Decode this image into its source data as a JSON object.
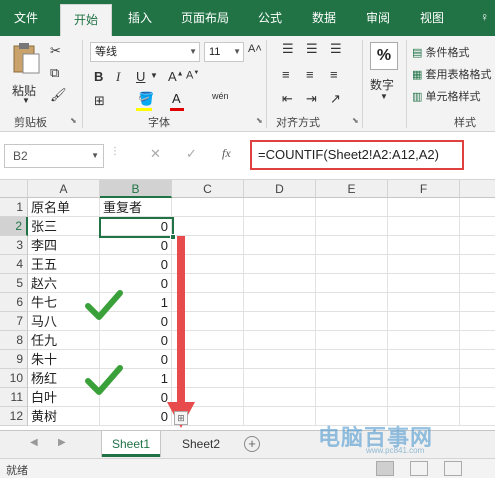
{
  "ribbon_tabs": [
    "文件",
    "开始",
    "插入",
    "页面布局",
    "公式",
    "数据",
    "审阅",
    "视图"
  ],
  "active_tab": "开始",
  "help_icon": "lightbulb-icon",
  "help_text": "♀",
  "clipboard": {
    "paste": "粘贴",
    "label": "剪贴板"
  },
  "font": {
    "name": "等线",
    "size": "11",
    "label": "字体",
    "bold": "B",
    "italic": "I",
    "underline": "U",
    "font_color_letter": "A",
    "phonetic": "wén"
  },
  "alignment": {
    "label": "对齐方式"
  },
  "number": {
    "icon_text": "%",
    "label": "数字"
  },
  "styles": {
    "conditional": "条件格式",
    "table": "套用表格格式",
    "cell": "单元格样式",
    "label": "样式"
  },
  "formula_bar": {
    "name_box": "B2",
    "cancel": "✕",
    "enter": "✓",
    "fx": "fx",
    "formula": "=COUNTIF(Sheet2!A2:A12,A2)"
  },
  "columns": [
    "A",
    "B",
    "C",
    "D",
    "E",
    "F"
  ],
  "rows": [
    {
      "num": "1",
      "a": "原名单",
      "b": "重复者"
    },
    {
      "num": "2",
      "a": "张三",
      "b": "0"
    },
    {
      "num": "3",
      "a": "李四",
      "b": "0"
    },
    {
      "num": "4",
      "a": "王五",
      "b": "0"
    },
    {
      "num": "5",
      "a": "赵六",
      "b": "0"
    },
    {
      "num": "6",
      "a": "牛七",
      "b": "1"
    },
    {
      "num": "7",
      "a": "马八",
      "b": "0"
    },
    {
      "num": "8",
      "a": "任九",
      "b": "0"
    },
    {
      "num": "9",
      "a": "朱十",
      "b": "0"
    },
    {
      "num": "10",
      "a": "杨红",
      "b": "1"
    },
    {
      "num": "11",
      "a": "白叶",
      "b": "0"
    },
    {
      "num": "12",
      "a": "黄树",
      "b": "0"
    }
  ],
  "sheets": [
    "Sheet1",
    "Sheet2"
  ],
  "active_sheet": "Sheet1",
  "status": "就绪",
  "watermark": {
    "main": "电脑百事网",
    "sub": "www.pc841.com"
  },
  "colors": {
    "excel_green": "#217346",
    "annotation_red": "#e84b4b",
    "check_green": "#3aa13a"
  }
}
